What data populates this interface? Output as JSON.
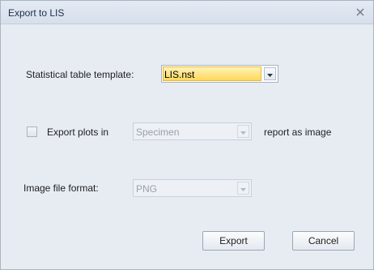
{
  "window": {
    "title": "Export to LIS"
  },
  "template": {
    "label": "Statistical table template:",
    "value": "LIS.nst"
  },
  "plots": {
    "label": "Export plots in",
    "value": "Specimen",
    "suffix": "report as image",
    "checked": false
  },
  "image": {
    "label": "Image file format:",
    "value": "PNG"
  },
  "buttons": {
    "export": "Export",
    "cancel": "Cancel"
  },
  "icons": {
    "close": "close-icon",
    "dropdown": "chevron-down-icon"
  }
}
